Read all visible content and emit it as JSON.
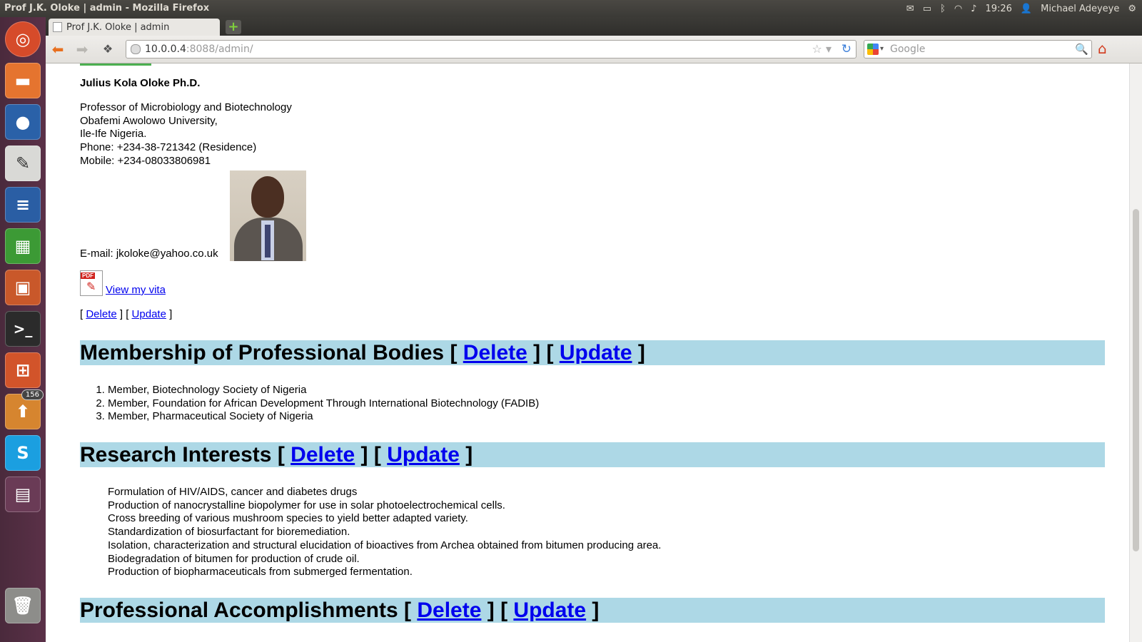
{
  "window_title": "Prof J.K. Oloke | admin - Mozilla Firefox",
  "tray": {
    "time": "19:26",
    "user": "Michael Adeyeye"
  },
  "launcher": {
    "badge": "156"
  },
  "tab": {
    "title": "Prof J.K. Oloke | admin"
  },
  "url": {
    "host": "10.0.0.4",
    "rest": ":8088/admin/"
  },
  "search": {
    "placeholder": "Google"
  },
  "profile": {
    "name": "Julius Kola Oloke Ph.D.",
    "lines": [
      "Professor of Microbiology and Biotechnology",
      "Obafemi Awolowo University,",
      "Ile-Ife Nigeria.",
      "Phone: +234-38-721342 (Residence)",
      "Mobile: +234-08033806981"
    ],
    "email": "E-mail: jkoloke@yahoo.co.uk",
    "vita_link": "View my vita"
  },
  "actions": {
    "delete": "Delete",
    "update": "Update"
  },
  "sections": {
    "membership": {
      "title": "Membership of Professional Bodies",
      "items": [
        "Member, Biotechnology Society of Nigeria",
        "Member, Foundation for African Development Through International Biotechnology (FADIB)",
        "Member, Pharmaceutical Society of Nigeria"
      ]
    },
    "research": {
      "title": "Research Interests",
      "items": [
        "Formulation of HIV/AIDS, cancer and diabetes drugs",
        "Production of nanocrystalline biopolymer for use in solar photoelectrochemical cells.",
        "Cross breeding of various mushroom species to yield better adapted variety.",
        "Standardization of biosurfactant for bioremediation.",
        "Isolation, characterization and structural elucidation of bioactives from Archea obtained from bitumen producing area.",
        "Biodegradation of bitumen for production of crude oil.",
        "Production of biopharmaceuticals from submerged fermentation."
      ]
    },
    "accomplishments": {
      "title": "Professional Accomplishments"
    }
  }
}
